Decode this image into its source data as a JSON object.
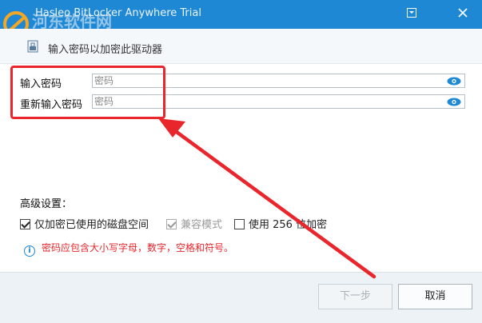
{
  "window": {
    "title": "Hasleo BitLocker Anywhere Trial",
    "watermark_text": "www.pc0359.cn"
  },
  "header": {
    "text": "输入密码以加密此驱动器"
  },
  "form": {
    "password_label": "输入密码",
    "password_placeholder": "密码",
    "confirm_label": "重新输入密码",
    "confirm_placeholder": "密码"
  },
  "advanced": {
    "title": "高级设置：",
    "options": [
      {
        "label": "仅加密已使用的磁盘空间",
        "checked": true,
        "enabled": true
      },
      {
        "label": "兼容模式",
        "checked": true,
        "enabled": false
      },
      {
        "label": "使用 256 位加密",
        "checked": false,
        "enabled": true
      }
    ]
  },
  "hint": {
    "text": "密码应包含大小写字母，数字，空格和符号。"
  },
  "buttons": {
    "next_label": "下一步",
    "cancel_label": "取消"
  },
  "colors": {
    "titlebar": "#1e88d4",
    "annotation_red": "#e8262b",
    "hint_red": "#e8262b"
  }
}
